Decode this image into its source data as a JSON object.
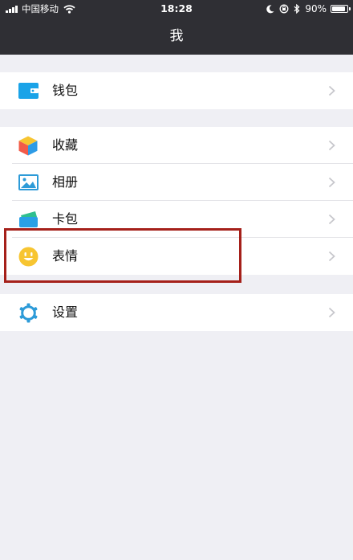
{
  "status_bar": {
    "carrier": "中国移动",
    "time": "18:28",
    "battery": "90%",
    "battery_level": 0.9
  },
  "nav": {
    "title": "我"
  },
  "sections": [
    {
      "items": [
        {
          "label": "钱包",
          "icon": "wallet-icon"
        }
      ]
    },
    {
      "items": [
        {
          "label": "收藏",
          "icon": "cube-icon"
        },
        {
          "label": "相册",
          "icon": "photo-album-icon"
        },
        {
          "label": "卡包",
          "icon": "card-wallet-icon"
        },
        {
          "label": "表情",
          "icon": "smiley-face-icon"
        }
      ]
    },
    {
      "items": [
        {
          "label": "设置",
          "icon": "gear-icon"
        }
      ]
    }
  ],
  "colors": {
    "nav_background": "#2f2f34",
    "page_background": "#efeff4",
    "highlight_border": "#a5201a",
    "wallet_blue": "#1aa3e8",
    "smiley_yellow": "#f7c531",
    "gear_blue": "#2d9bd8"
  }
}
